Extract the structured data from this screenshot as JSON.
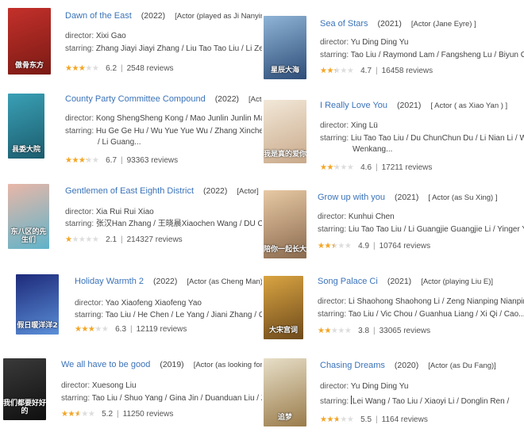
{
  "director_label": "director:",
  "starring_label": "starring:",
  "reviews_suffix": "reviews",
  "star_color": "#f5a623",
  "title_color": "#3b73b9",
  "movies": [
    {
      "title": "Dawn of the East",
      "year": "(2022)",
      "role": "[Actor (played as Ji Nanyin)]",
      "director": "Xixi Gao",
      "starring": [
        "Zhang Jiayi Jiayi Zhang / Liu Tao Tao Liu / Li Zefeng"
      ],
      "rating": "6.2",
      "reviews": "2548",
      "stars_fraction": 0.62,
      "poster_colors": [
        "#c4302b",
        "#7a1a14"
      ],
      "poster_text": "傲骨东方"
    },
    {
      "title": "County Party Committee Compound",
      "year": "(2022)",
      "role": "[Actor (as",
      "director": "Kong ShengSheng Kong / Mao Junlin Junlin Mao /",
      "starring": [
        "Hu Ge Ge Hu / Wu Yue Yue Wu / Zhang Xincheng /",
        "/ Li Guang..."
      ],
      "rating": "6.7",
      "reviews": "93363",
      "stars_fraction": 0.67,
      "poster_colors": [
        "#3aa0b5",
        "#1b5c6e"
      ],
      "poster_text": "县委大院"
    },
    {
      "title": "Gentlemen of East Eighth District",
      "year": "(2022)",
      "role": "[Actor]",
      "director": "Xia Rui Rui Xiao",
      "starring": [
        "张汉Han Zhang / 王晓晨Xiaochen Wang / DU Chun"
      ],
      "rating": "2.1",
      "reviews": "214327",
      "stars_fraction": 0.21,
      "poster_colors": [
        "#e9b7a8",
        "#5fb3c9"
      ],
      "poster_text": "东八区的先生们"
    },
    {
      "title": "Holiday Warmth 2",
      "year": "(2022)",
      "role": "[Actor (as Cheng Man) ]",
      "director": "Yao Xiaofeng Xiaofeng Yao",
      "starring": [
        "Tao Liu / He Chen / Le Yang / Jiani Zhang / Che"
      ],
      "rating": "6.3",
      "reviews": "12119",
      "stars_fraction": 0.63,
      "poster_colors": [
        "#1d2a7a",
        "#5b8fd8"
      ],
      "poster_text": "假日暖洋洋2"
    },
    {
      "title": "We all have to be good",
      "year": "(2019)",
      "role": "[Actor (as looking for)]",
      "director": "Xuesong Liu",
      "starring": [
        "Tao Liu / Shuo Yang / Gina Jin / Duanduan Liu / Zhang"
      ],
      "rating": "5.2",
      "reviews": "11250",
      "stars_fraction": 0.52,
      "poster_colors": [
        "#3a3a3a",
        "#0f0f0f"
      ],
      "poster_text": "我们都要好好的"
    },
    {
      "title": "Sea of Stars",
      "year": "(2021)",
      "role": "[Actor (Jane Eyre) ]",
      "director": "Yu Ding Ding Yu",
      "starring": [
        "Tao Liu / Raymond Lam / Fangsheng Lu / Biyun Cha"
      ],
      "rating": "4.7",
      "reviews": "16458",
      "stars_fraction": 0.47,
      "poster_colors": [
        "#8fb4d6",
        "#2d4d78"
      ],
      "poster_text": "星辰大海"
    },
    {
      "title": "I Really Love You",
      "year": "(2021)",
      "role": "[ Actor ( as Xiao Yan ) ]",
      "director": "Xing Lü",
      "starring": [
        "Liu Tao Tao Liu / Du ChunChun Du / Li Nian Li / Wang",
        "Wenkang..."
      ],
      "rating": "4.6",
      "reviews": "17211",
      "stars_fraction": 0.46,
      "poster_colors": [
        "#f2e8d8",
        "#c9a98a"
      ],
      "poster_text": "我是真的爱你"
    },
    {
      "title": "Grow up with you",
      "year": "(2021)",
      "role": "[ Actor (as Su Xing) ]",
      "director": "Kunhui Chen",
      "starring": [
        "Liu Tao Tao Liu / Li Guangjie Guangjie Li / Yinger Ying"
      ],
      "rating": "4.9",
      "reviews": "10764",
      "stars_fraction": 0.49,
      "poster_colors": [
        "#e8c9a4",
        "#8a6a4e"
      ],
      "poster_text": "陪你一起长大"
    },
    {
      "title": "Song Palace Ci",
      "year": "(2021)",
      "role": "[Actor (playing Liu E)]",
      "director": "Li Shaohong Shaohong Li / Zeng Nianping Nianping",
      "starring": [
        "Tao Liu / Vic Chou / Guanhua Liang / Xi Qi / Cao..."
      ],
      "rating": "3.8",
      "reviews": "33065",
      "stars_fraction": 0.38,
      "poster_colors": [
        "#d9a441",
        "#6e4a1c"
      ],
      "poster_text": "大宋宫词"
    },
    {
      "title": "Chasing Dreams",
      "year": "(2020)",
      "role": "[Actor (as Du Fang)]",
      "director": "Yu Ding Ding Yu",
      "starring": [
        "Lei Wang / Tao Liu / Xiaoyi Li / Donglin Ren /"
      ],
      "rating": "5.5",
      "reviews": "1164",
      "stars_fraction": 0.55,
      "poster_colors": [
        "#e7dfc8",
        "#9a7b4a"
      ],
      "poster_text": "追梦"
    }
  ]
}
